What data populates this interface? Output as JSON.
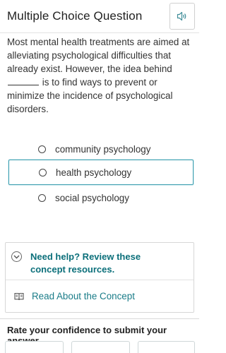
{
  "header": {
    "title": "Multiple Choice Question",
    "audio_icon": "speaker-icon"
  },
  "question": {
    "text_before": "Most mental health treatments are aimed at alleviating psychological difficulties that already exist. However, the idea behind",
    "text_after": "is to find ways to prevent or minimize the incidence of psychological disorders."
  },
  "options": [
    {
      "label": "community psychology",
      "selected": false
    },
    {
      "label": "health psychology",
      "selected": true
    },
    {
      "label": "social psychology",
      "selected": false
    }
  ],
  "help": {
    "toggle_label": "Need help? Review these concept resources.",
    "link_label": "Read About the Concept",
    "link_icon": "book-icon"
  },
  "confidence": {
    "prompt": "Rate your confidence to submit your answer."
  },
  "colors": {
    "accent": "#0b6f7a",
    "link": "#1a7c88",
    "selected_border": "#3f9fb0"
  }
}
